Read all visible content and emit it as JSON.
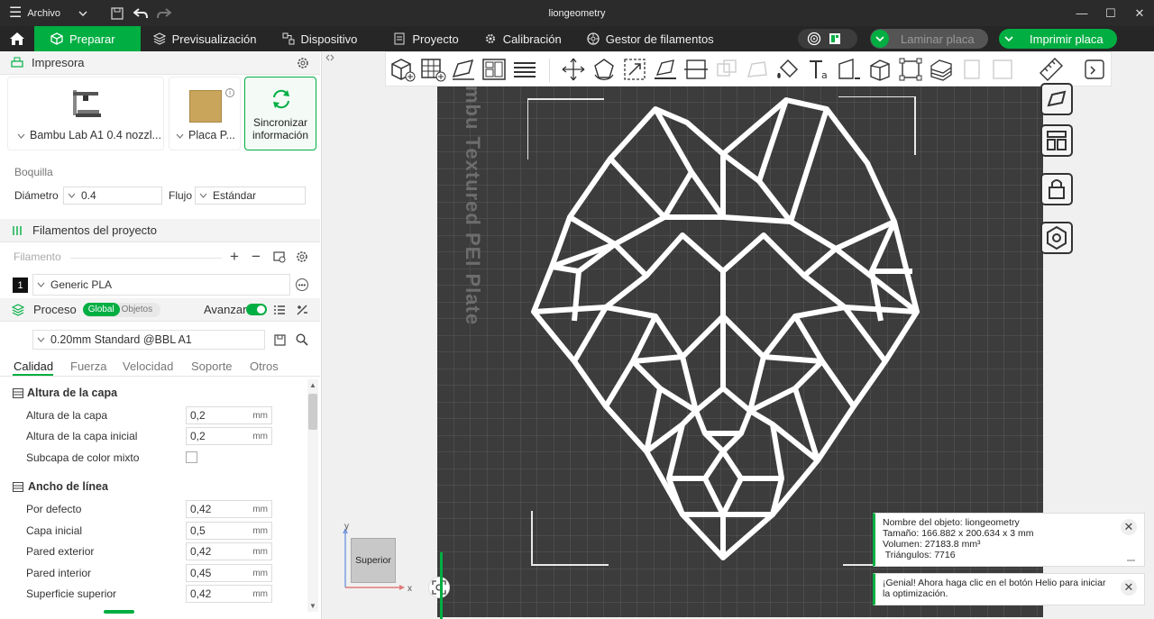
{
  "titlebar": {
    "menu_label": "Archivo",
    "window_title": "liongeometry"
  },
  "nav": {
    "tabs": [
      {
        "label": "Preparar"
      },
      {
        "label": "Previsualización"
      },
      {
        "label": "Dispositivo"
      },
      {
        "label": "Proyecto"
      },
      {
        "label": "Calibración"
      },
      {
        "label": "Gestor de filamentos"
      }
    ],
    "slice_label": "Laminar placa",
    "print_label": "Imprimir placa"
  },
  "printer": {
    "header": "Impresora",
    "printer_name": "Bambu Lab A1 0.4 nozzl...",
    "plate_name": "Placa P...",
    "sync_label": "Sincronizar información",
    "nozzle_label": "Boquilla",
    "diameter_label": "Diámetro",
    "diameter_value": "0.4",
    "flow_label": "Flujo",
    "flow_value": "Estándar"
  },
  "filaments": {
    "header": "Filamentos del proyecto",
    "placeholder": "Filamento",
    "items": [
      {
        "index": "1",
        "name": "Generic PLA"
      }
    ]
  },
  "process": {
    "header": "Proceso",
    "toggle_global": "Global",
    "toggle_objects": "Objetos",
    "advanced_label": "Avanzar",
    "advanced_on": true,
    "preset": "0.20mm Standard @BBL A1",
    "tabs": [
      "Calidad",
      "Fuerza",
      "Velocidad",
      "Soporte",
      "Otros"
    ],
    "active_tab": "Calidad",
    "groups": [
      {
        "title": "Altura de la capa",
        "rows": [
          {
            "label": "Altura de la capa",
            "value": "0,2",
            "unit": "mm"
          },
          {
            "label": "Altura de la capa inicial",
            "value": "0,2",
            "unit": "mm"
          },
          {
            "label": "Subcapa de color mixto",
            "checkbox": true,
            "checked": false
          }
        ]
      },
      {
        "title": "Ancho de línea",
        "rows": [
          {
            "label": "Por defecto",
            "value": "0,42",
            "unit": "mm"
          },
          {
            "label": "Capa inicial",
            "value": "0,5",
            "unit": "mm"
          },
          {
            "label": "Pared exterior",
            "value": "0,42",
            "unit": "mm"
          },
          {
            "label": "Pared interior",
            "value": "0,45",
            "unit": "mm"
          },
          {
            "label": "Superficie superior",
            "value": "0,42",
            "unit": "mm"
          }
        ]
      }
    ]
  },
  "viewport": {
    "plate_label": "mbu Textured PEI Plate",
    "view_cube_label": "Superior",
    "axis_x": "x",
    "axis_y": "y"
  },
  "notifications": [
    {
      "lines": [
        "Nombre del objeto: liongeometry",
        "Tamaño: 166.882 x 200.634 x 3 mm",
        "Volumen: 27183.8 mm³",
        " Triángulos: 7716"
      ]
    },
    {
      "lines": [
        "¡Genial! Ahora haga clic en el botón Helio para iniciar",
        "la optimización."
      ]
    }
  ],
  "colors": {
    "accent": "#00ae42",
    "dark": "#262626",
    "plate": "#3c3c3c"
  }
}
